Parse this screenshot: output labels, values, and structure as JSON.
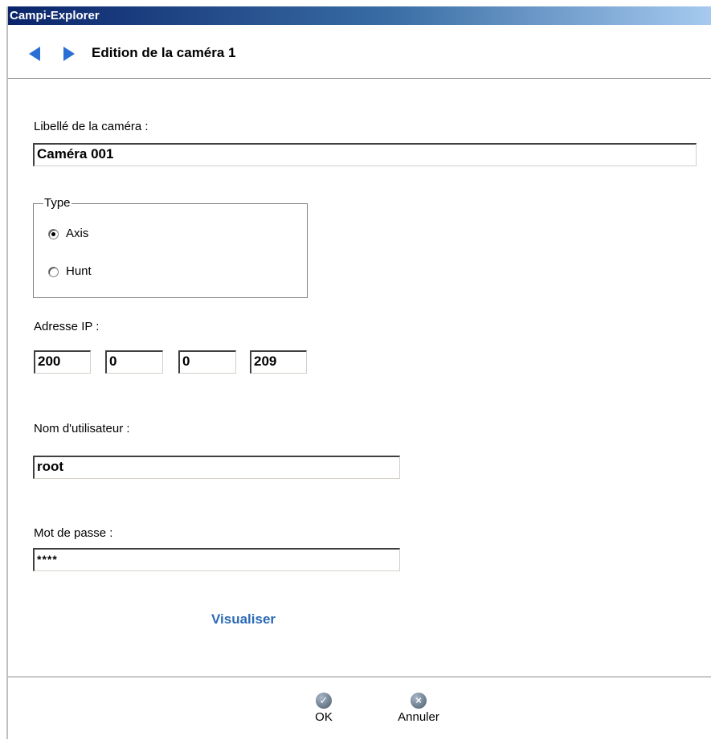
{
  "window": {
    "title": "Campi-Explorer"
  },
  "nav": {
    "title": "Edition de la caméra 1"
  },
  "form": {
    "label_camera": "Libellé de la caméra :",
    "camera_value": "Caméra 001",
    "type_legend": "Type",
    "type_options": [
      "Axis",
      "Hunt"
    ],
    "type_selected": "Axis",
    "ip_label": "Adresse IP :",
    "ip": [
      "200",
      "0",
      "0",
      "209"
    ],
    "user_label": "Nom d'utilisateur :",
    "user_value": "root",
    "password_label": "Mot de passe :",
    "password_value": "****",
    "visualize_link": "Visualiser"
  },
  "buttons": {
    "ok": "OK",
    "cancel": "Annuler"
  },
  "colors": {
    "accent": "#2a6fd6",
    "link": "#2a6ab5",
    "titlebar": "#0a246a"
  }
}
